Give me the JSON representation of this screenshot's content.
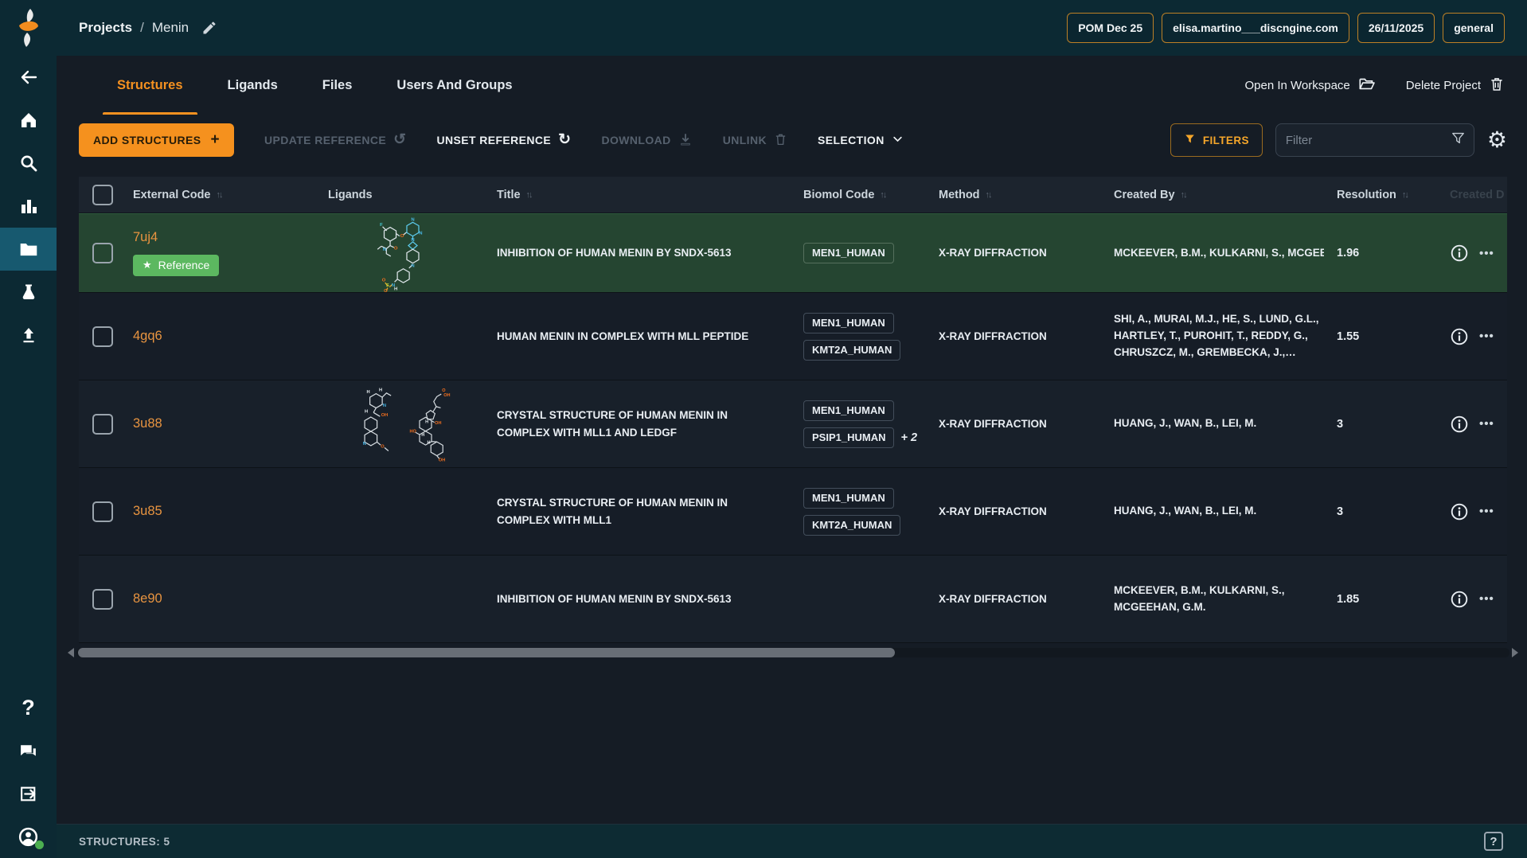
{
  "header": {
    "breadcrumb": {
      "root": "Projects",
      "separator": "/",
      "current": "Menin"
    },
    "edit_icon": "pencil-icon",
    "tags": [
      {
        "label": "POM Dec 25"
      },
      {
        "label": "elisa.martino___discngine.com"
      },
      {
        "label": "26/11/2025"
      },
      {
        "label": "general"
      }
    ]
  },
  "sidebar": {
    "icons": [
      "app-logo",
      "back-icon",
      "home-icon",
      "search-icon",
      "bar-chart-icon",
      "folder-icon",
      "flask-icon",
      "upload-icon",
      "help-icon",
      "feedback-icon",
      "logout-icon",
      "account-icon"
    ],
    "active_icon": "folder-icon",
    "account_status": "online"
  },
  "tabs": [
    {
      "label": "Structures",
      "active": true
    },
    {
      "label": "Ligands",
      "active": false
    },
    {
      "label": "Files",
      "active": false
    },
    {
      "label": "Users And Groups",
      "active": false
    }
  ],
  "project_actions": {
    "open_in_workspace": "Open In Workspace",
    "delete_project": "Delete Project"
  },
  "toolbar": {
    "add_structures": "ADD STRUCTURES",
    "update_reference": "UPDATE REFERENCE",
    "unset_reference": "UNSET REFERENCE",
    "download": "DOWNLOAD",
    "unlink": "UNLINK",
    "selection": "SELECTION",
    "filters": "FILTERS",
    "filter_placeholder": "Filter"
  },
  "table": {
    "columns": {
      "external_code": "External Code",
      "ligands": "Ligands",
      "title": "Title",
      "biomol_code": "Biomol Code",
      "method": "Method",
      "created_by": "Created By",
      "resolution": "Resolution",
      "created_date_truncated": "Created D"
    },
    "rows": [
      {
        "external_code": "7uj4",
        "reference_badge": "Reference",
        "ligand_images": [
          "sndx-5613-structure"
        ],
        "title": "INHIBITION OF HUMAN MENIN BY SNDX-5613",
        "biomol_codes": [
          "MEN1_HUMAN"
        ],
        "biomol_extra": "",
        "method": "X-RAY DIFFRACTION",
        "created_by": "MCKEEVER, B.M., KULKARNI, S., MCGEE",
        "resolution": "1.96"
      },
      {
        "external_code": "4gq6",
        "ligand_images": [],
        "title": "HUMAN MENIN IN COMPLEX WITH MLL PEPTIDE",
        "biomol_codes": [
          "MEN1_HUMAN",
          "KMT2A_HUMAN"
        ],
        "biomol_extra": "",
        "method": "X-RAY DIFFRACTION",
        "created_by": "SHI, A., MURAI, M.J., HE, S., LUND, G.L., HARTLEY, T., PUROHIT, T., REDDY, G., CHRUSZCZ, M., GREMBECKA, J.,…",
        "resolution": "1.55"
      },
      {
        "external_code": "3u88",
        "ligand_images": [
          "quinoline-alkaloid-structure",
          "steroid-acid-structure"
        ],
        "title": "CRYSTAL STRUCTURE OF HUMAN MENIN IN COMPLEX WITH MLL1 AND LEDGF",
        "biomol_codes": [
          "MEN1_HUMAN",
          "PSIP1_HUMAN"
        ],
        "biomol_extra": "+ 2",
        "method": "X-RAY DIFFRACTION",
        "created_by": "HUANG, J., WAN, B., LEI, M.",
        "resolution": "3"
      },
      {
        "external_code": "3u85",
        "ligand_images": [],
        "title": "CRYSTAL STRUCTURE OF HUMAN MENIN IN COMPLEX WITH MLL1",
        "biomol_codes": [
          "MEN1_HUMAN",
          "KMT2A_HUMAN"
        ],
        "biomol_extra": "",
        "method": "X-RAY DIFFRACTION",
        "created_by": "HUANG, J., WAN, B., LEI, M.",
        "resolution": "3"
      },
      {
        "external_code": "8e90",
        "ligand_images": [],
        "title": "INHIBITION OF HUMAN MENIN BY SNDX-5613",
        "biomol_codes": [],
        "biomol_extra": "",
        "method": "X-RAY DIFFRACTION",
        "created_by": "MCKEEVER, B.M., KULKARNI, S., MCGEEHAN, G.M.",
        "resolution": "1.85"
      }
    ]
  },
  "status_bar": {
    "structures_count": "STRUCTURES: 5"
  },
  "colors": {
    "accent_orange": "#f59120",
    "reference_green": "#5cb860",
    "row_highlight_green": "#254531",
    "sidebar_teal": "#0c2933",
    "active_item_teal": "#17596f",
    "tag_border_orange": "#bd8026"
  }
}
